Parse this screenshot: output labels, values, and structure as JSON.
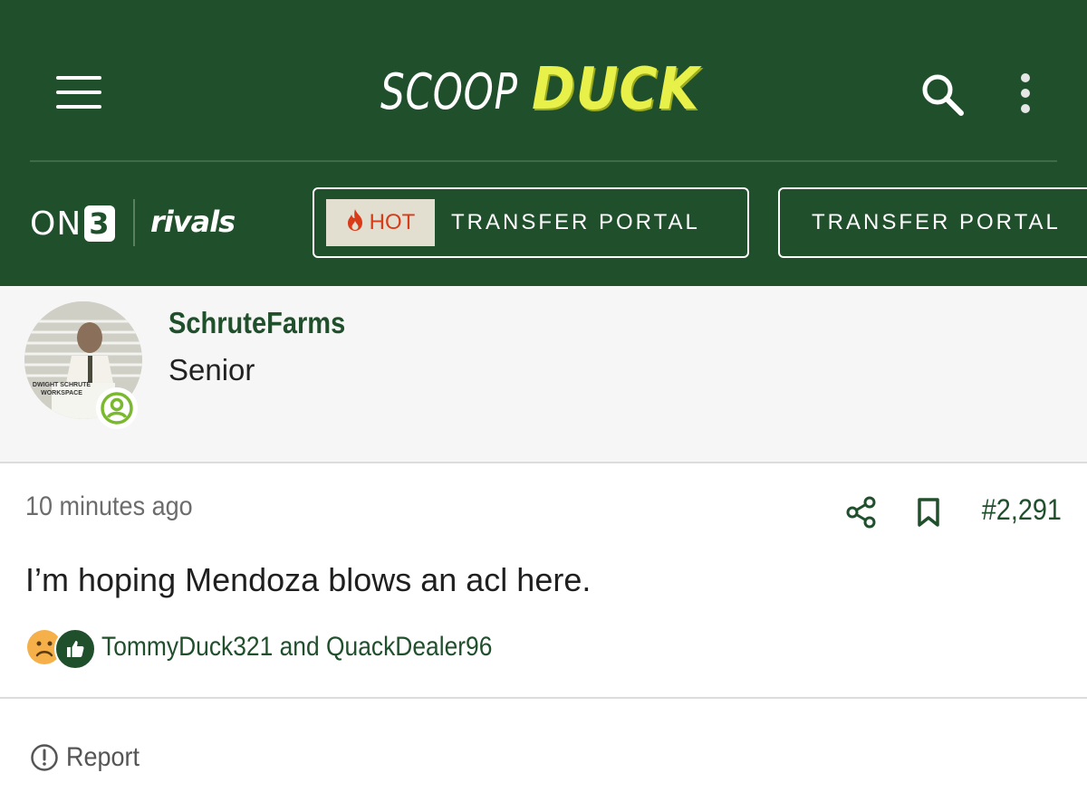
{
  "header": {
    "logo": {
      "part1": "SCOOP",
      "part2": "DUCK"
    },
    "brands": {
      "on3_prefix": "ON",
      "on3_suffix": "3",
      "rivals": "rivals"
    },
    "nav_pills": [
      {
        "badge": "HOT",
        "label": "TRANSFER PORTAL"
      },
      {
        "label": "TRANSFER PORTAL"
      }
    ]
  },
  "author": {
    "username": "SchruteFarms",
    "rank": "Senior",
    "avatar_caption": "DWIGHT SCHRUTE WORKSPACE"
  },
  "post": {
    "timestamp": "10 minutes ago",
    "number": "#2,291",
    "body": "I’m hoping Mendoza blows an acl here.",
    "reactors": "TommyDuck321 and QuackDealer96"
  },
  "actions": {
    "report_label": "Report"
  },
  "colors": {
    "brand_green": "#204f2c",
    "accent_yellow": "#e8f04a",
    "hot_red": "#d93a17",
    "online_green": "#7ab830"
  }
}
